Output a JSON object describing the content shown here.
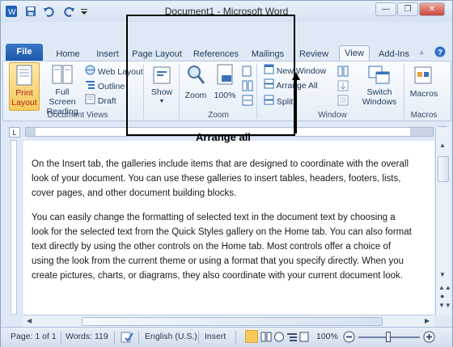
{
  "window": {
    "title": "Document1 - Microsoft Word"
  },
  "tabs": [
    {
      "label": "File"
    },
    {
      "label": "Home"
    },
    {
      "label": "Insert"
    },
    {
      "label": "Page Layout"
    },
    {
      "label": "References"
    },
    {
      "label": "Mailings"
    },
    {
      "label": "Review"
    },
    {
      "label": "View"
    },
    {
      "label": "Add-Ins"
    }
  ],
  "ribbon": {
    "document_views": {
      "label": "Document Views",
      "print_layout": "Print Layout",
      "print_layout_l1": "Print",
      "print_layout_l2": "Layout",
      "full_screen_l1": "Full Screen",
      "full_screen_l2": "Reading",
      "web_layout": "Web Layout",
      "outline": "Outline",
      "draft": "Draft"
    },
    "show": {
      "label": "Show"
    },
    "zoom": {
      "label": "Zoom",
      "zoom": "Zoom",
      "hundred": "100%"
    },
    "window": {
      "label": "Window",
      "new_window": "New Window",
      "arrange_all": "Arrange All",
      "split": "Split",
      "switch_l1": "Switch",
      "switch_l2": "Windows"
    },
    "macros": {
      "label": "Macros",
      "macros": "Macros"
    }
  },
  "annotation": "Arrange all",
  "document": {
    "para1": [
      "On the Insert tab, the galleries include items that are designed to coordinate with the overall",
      "look of your document. You can use these galleries to insert tables, headers, footers, lists,",
      "cover pages, and other document building blocks."
    ],
    "para2": [
      "You can easily change the formatting of selected text in the document text by choosing a",
      "look for the selected text from the Quick Styles gallery on the Home tab. You can also format",
      "text directly by using the other controls on the Home tab. Most controls offer a choice of",
      "using the look from the current theme or using a format that you specify directly. When you",
      "create pictures, charts, or diagrams, they also coordinate with your current document look."
    ]
  },
  "status": {
    "page": "Page: 1 of 1",
    "words": "Words: 119",
    "language": "English (U.S.)",
    "mode": "Insert",
    "zoom": "100%"
  },
  "colors": {
    "accent": "#1c57a8",
    "ribbon_border": "#b6c8e0"
  }
}
